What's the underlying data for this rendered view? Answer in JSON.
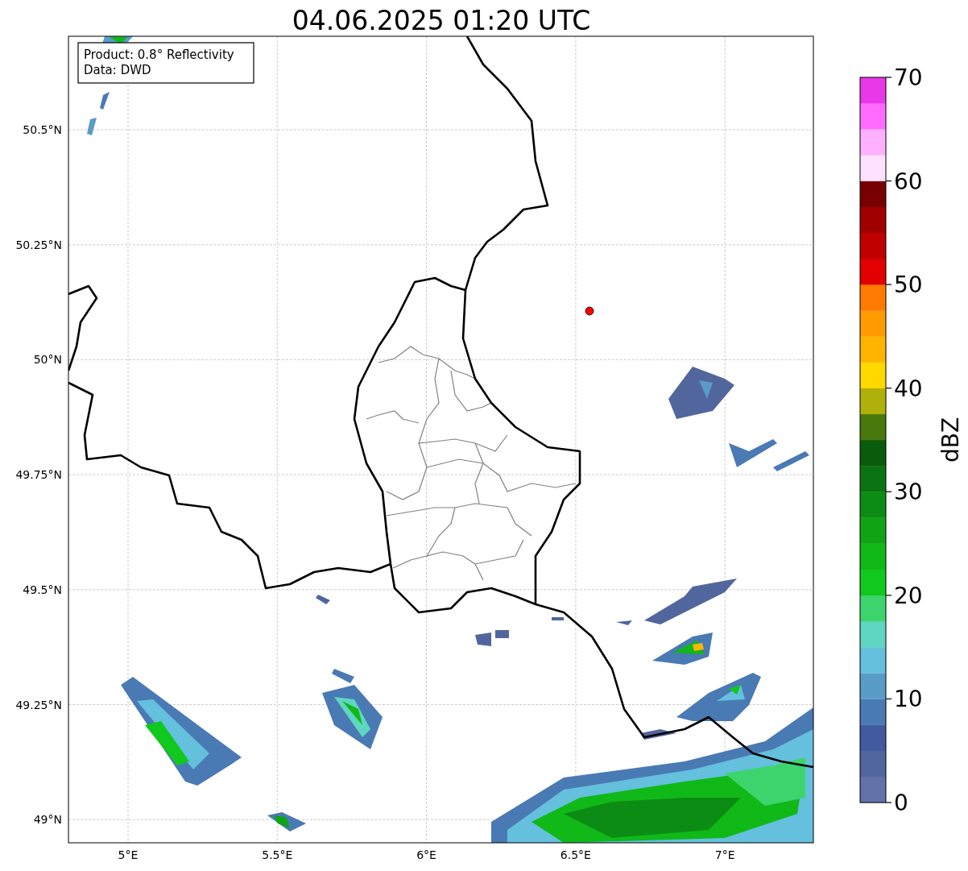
{
  "title": "04.06.2025 01:20 UTC",
  "legend": [
    "Product: 0.8° Reflectivity",
    "Data: DWD"
  ],
  "map": {
    "lat_labels": [
      "50.5°N",
      "50.25°N",
      "50°N",
      "49.75°N",
      "49.5°N",
      "49.25°N",
      "49°N"
    ],
    "lon_labels": [
      "5°E",
      "5.5°E",
      "6°E",
      "6.5°E",
      "7°E"
    ]
  },
  "colorbar": {
    "label": "dBZ",
    "ticks": [
      "70",
      "60",
      "50",
      "40",
      "30",
      "20",
      "10",
      "0"
    ],
    "bands": [
      {
        "color": "#6272a8"
      },
      {
        "color": "#52669e"
      },
      {
        "color": "#415aa0"
      },
      {
        "color": "#4a7ab4"
      },
      {
        "color": "#5a9cc8"
      },
      {
        "color": "#64c0dc"
      },
      {
        "color": "#5fd6c2"
      },
      {
        "color": "#3dd46e"
      },
      {
        "color": "#10c81e"
      },
      {
        "color": "#10b818"
      },
      {
        "color": "#10a414"
      },
      {
        "color": "#0c8c14"
      },
      {
        "color": "#0a7412"
      },
      {
        "color": "#085c0c"
      },
      {
        "color": "#48780c"
      },
      {
        "color": "#b0b00a"
      },
      {
        "color": "#ffd800"
      },
      {
        "color": "#ffb400"
      },
      {
        "color": "#ff9a00"
      },
      {
        "color": "#ff7a00"
      },
      {
        "color": "#e20000"
      },
      {
        "color": "#c00000"
      },
      {
        "color": "#a00000"
      },
      {
        "color": "#780000"
      },
      {
        "color": "#ffe0ff"
      },
      {
        "color": "#ffb0ff"
      },
      {
        "color": "#ff6cff"
      },
      {
        "color": "#e838e8"
      }
    ]
  }
}
